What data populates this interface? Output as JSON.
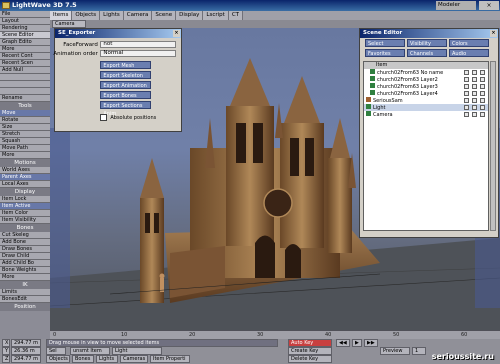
{
  "app": {
    "title": "LightWave 3D 7.5",
    "mode_button": "Modeler",
    "close": "×"
  },
  "tabs": [
    "Items",
    "Objects",
    "Lights",
    "Camera",
    "Scene",
    "Display",
    "Lscript",
    "CT"
  ],
  "camera_select": "Camera",
  "left_panel": {
    "top_buttons": [
      "File",
      "Layout",
      "Rendering",
      "Scene Editor",
      "Graph Edito",
      "More",
      "Recent Cont",
      "Recent Scen",
      "Add Null",
      "",
      "",
      "",
      "Rename"
    ],
    "tools_label": "Tools",
    "tools": [
      "Move",
      "Rotate",
      "Size",
      "Stretch",
      "Squash",
      "Move Path",
      "More"
    ],
    "motions_label": "Motions",
    "motions": [
      "World Axes",
      "Parent Axes",
      "Local Axes"
    ],
    "display_label": "Display",
    "display": [
      "Item Lock",
      "Item Active",
      "Item Color",
      "Item Visibility"
    ],
    "bones_label": "Bones",
    "bones": [
      "Cut Skeleg",
      "Add Bone",
      "Draw Bones",
      "Draw Child",
      "Add Child Bo",
      "Bone Weights",
      "More"
    ],
    "ik_label": "IK",
    "ik": [
      "Limits",
      "BonesEdit"
    ],
    "position_label": "Position"
  },
  "exporter": {
    "title": "SE_Exporter",
    "faceforward_label": "FaceForward",
    "faceforward_value": "not",
    "anim_order_label": "Animation order",
    "anim_order_value": "Normal",
    "buttons": [
      "Export Mesh",
      "Export Skeleton",
      "Export Animation",
      "Export Bones",
      "Export Sections Anim"
    ],
    "absolute_label": "Absolute positions"
  },
  "scene_editor": {
    "title": "Scene Editor",
    "row1": [
      "Select",
      "Visibility",
      "Colors"
    ],
    "row2": [
      "Favorites",
      "Channels",
      "Audio"
    ],
    "col_item": "Item",
    "items": [
      "church02From63 No name",
      "church02From63 Layer2",
      "church02From63 Layer3",
      "church02From63 Layer4",
      "SeriousSam",
      "Light",
      "Camera"
    ]
  },
  "timeline": {
    "ticks": [
      "0",
      "10",
      "20",
      "30",
      "40",
      "50",
      "60"
    ]
  },
  "bottom": {
    "x_label": "X",
    "x_val": "294.77 m",
    "y_label": "Y",
    "y_val": "26.36 m",
    "z_label": "Z",
    "z_val": "294.77 m",
    "grid_label": "Grid",
    "grid_val": "2.1 m",
    "status": "Drag mouse in view to move selected items",
    "sel_label": "Sel",
    "sel_val": "unsmt Item",
    "light_label": "Light",
    "btns": [
      "Objects",
      "Bones",
      "Lights",
      "Cameras",
      "Item Properti"
    ],
    "autokey": "Auto Key",
    "create_key": "Create Key",
    "delete_key": "Delete Key",
    "preview": "Preview",
    "step": "1",
    "watermark": "serioussite.ru"
  },
  "colors": {
    "accent": "#0a246a",
    "button_blue": "#6a7eb0",
    "viewport": "#6878a0"
  }
}
